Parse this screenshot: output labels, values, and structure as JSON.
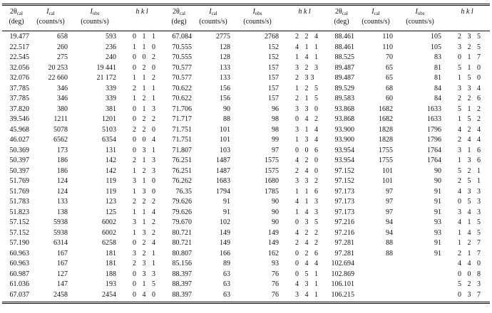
{
  "headers": [
    {
      "sym": "2θ",
      "sub": "cal",
      "unit": "(deg)"
    },
    {
      "sym": "I",
      "sub": "cal",
      "unit": "(counts/s)"
    },
    {
      "sym": "I",
      "sub": "obs",
      "unit": "(counts/s)"
    },
    {
      "sym": "h  k  l",
      "sub": "",
      "unit": ""
    }
  ],
  "rows": [
    [
      [
        "19.477",
        "658",
        "593",
        "0 1 1"
      ],
      [
        "67.084",
        "2775",
        "2768",
        "2 2 4"
      ],
      [
        "88.461",
        "110",
        "105",
        "2 3 5"
      ]
    ],
    [
      [
        "22.517",
        "260",
        "236",
        "1 1 0"
      ],
      [
        "70.555",
        "128",
        "152",
        "4 1 1"
      ],
      [
        "88.461",
        "110",
        "105",
        "3 2 5"
      ]
    ],
    [
      [
        "22.545",
        "275",
        "240",
        "0 0 2"
      ],
      [
        "70.555",
        "128",
        "152",
        "1 4 1"
      ],
      [
        "88.525",
        "70",
        "83",
        "0 1 7"
      ]
    ],
    [
      [
        "32.056",
        "20 253",
        "19 441",
        "0 2 0"
      ],
      [
        "70.577",
        "133",
        "157",
        "3 2 3"
      ],
      [
        "89.487",
        "65",
        "81",
        "5 1 0"
      ]
    ],
    [
      [
        "32.076",
        "22 660",
        "21 172",
        "1 1 2"
      ],
      [
        "70.577",
        "133",
        "157",
        "2 33"
      ],
      [
        "89.487",
        "65",
        "81",
        "1 5 0"
      ]
    ],
    [
      [
        "37.785",
        "346",
        "339",
        "2 1 1"
      ],
      [
        "70.622",
        "156",
        "157",
        "1 2 5"
      ],
      [
        "89.529",
        "68",
        "84",
        "3 3 4"
      ]
    ],
    [
      [
        "37.785",
        "346",
        "339",
        "1 2 1"
      ],
      [
        "70.622",
        "156",
        "157",
        "2 1 5"
      ],
      [
        "89.583",
        "60",
        "84",
        "2 2 6"
      ]
    ],
    [
      [
        "37.820",
        "380",
        "381",
        "0 1 3"
      ],
      [
        "71.706",
        "90",
        "96",
        "3 3 0"
      ],
      [
        "93.868",
        "1682",
        "1633",
        "5 1 2"
      ]
    ],
    [
      [
        "39.546",
        "1211",
        "1201",
        "0 2 2"
      ],
      [
        "71.717",
        "88",
        "98",
        "0 4 2"
      ],
      [
        "93.868",
        "1682",
        "1633",
        "1 5 2"
      ]
    ],
    [
      [
        "45.968",
        "5078",
        "5103",
        "2 2 0"
      ],
      [
        "71.751",
        "101",
        "98",
        "3 1 4"
      ],
      [
        "93.900",
        "1828",
        "1796",
        "4 2 4"
      ]
    ],
    [
      [
        "46.027",
        "6562",
        "6354",
        "0 0 4"
      ],
      [
        "71.751",
        "101",
        "99",
        "1 3 4"
      ],
      [
        "93.900",
        "1828",
        "1796",
        "2 4 4"
      ]
    ],
    [
      [
        "50.369",
        "173",
        "131",
        "0 3 1"
      ],
      [
        "71.807",
        "103",
        "97",
        "0 0 6"
      ],
      [
        "93.954",
        "1755",
        "1764",
        "3 1 6"
      ]
    ],
    [
      [
        "50.397",
        "186",
        "142",
        "2 1 3"
      ],
      [
        "76.251",
        "1487",
        "1575",
        "4 2 0"
      ],
      [
        "93.954",
        "1755",
        "1764",
        "1 3 6"
      ]
    ],
    [
      [
        "50.397",
        "186",
        "142",
        "1 2 3"
      ],
      [
        "76.251",
        "1487",
        "1575",
        "2 4 0"
      ],
      [
        "97.152",
        "101",
        "90",
        "5 2 1"
      ]
    ],
    [
      [
        "51.769",
        "124",
        "119",
        "3 1 0"
      ],
      [
        "76.262",
        "1683",
        "1680",
        "3 3 2"
      ],
      [
        "97.152",
        "101",
        "90",
        "2 5 1"
      ]
    ],
    [
      [
        "51.769",
        "124",
        "119",
        "1 3 0"
      ],
      [
        "76.35",
        "1794",
        "1785",
        "1 1 6"
      ],
      [
        "97.173",
        "97",
        "91",
        "4 3 3"
      ]
    ],
    [
      [
        "51.783",
        "133",
        "123",
        "2 2 2"
      ],
      [
        "79.626",
        "91",
        "90",
        "4 1 3"
      ],
      [
        "97.173",
        "97",
        "91",
        "0 5 3"
      ]
    ],
    [
      [
        "51.823",
        "138",
        "125",
        "1 1 4"
      ],
      [
        "79.626",
        "91",
        "90",
        "1 4 3"
      ],
      [
        "97.173",
        "97",
        "91",
        "3 4 3"
      ]
    ],
    [
      [
        "57.152",
        "5938",
        "6002",
        "3 1 2"
      ],
      [
        "79.670",
        "102",
        "90",
        "0 3 5"
      ],
      [
        "97.216",
        "94",
        "93",
        "4 1 5"
      ]
    ],
    [
      [
        "57.152",
        "5938",
        "6002",
        "1 3 2"
      ],
      [
        "80.721",
        "149",
        "149",
        "4 2 2"
      ],
      [
        "97.216",
        "94",
        "93",
        "1 4 5"
      ]
    ],
    [
      [
        "57.190",
        "6314",
        "6258",
        "0 2 4"
      ],
      [
        "80.721",
        "149",
        "149",
        "2 4 2"
      ],
      [
        "97.281",
        "88",
        "91",
        "1 2 7"
      ]
    ],
    [
      [
        "60.963",
        "167",
        "181",
        "3 2 1"
      ],
      [
        "80.807",
        "166",
        "162",
        "0 2 6"
      ],
      [
        "97.281",
        "88",
        "91",
        "2 1 7"
      ]
    ],
    [
      [
        "60.963",
        "167",
        "181",
        "2 3 1"
      ],
      [
        "85.156",
        "89",
        "93",
        "0 4 4"
      ],
      [
        "102.694",
        "",
        "",
        "4 4 0"
      ]
    ],
    [
      [
        "60.987",
        "127",
        "188",
        "0 3 3"
      ],
      [
        "88.397",
        "63",
        "76",
        "0 5 1"
      ],
      [
        "102.869",
        "",
        "",
        "0 0 8"
      ]
    ],
    [
      [
        "61.036",
        "147",
        "193",
        "0 1 5"
      ],
      [
        "88.397",
        "63",
        "76",
        "4 3 1"
      ],
      [
        "106.101",
        "",
        "",
        "5 2 3"
      ]
    ],
    [
      [
        "67.037",
        "2458",
        "2454",
        "0 4 0"
      ],
      [
        "88.397",
        "63",
        "76",
        "3 4 1"
      ],
      [
        "106.215",
        "",
        "",
        "0 3 7"
      ]
    ]
  ]
}
